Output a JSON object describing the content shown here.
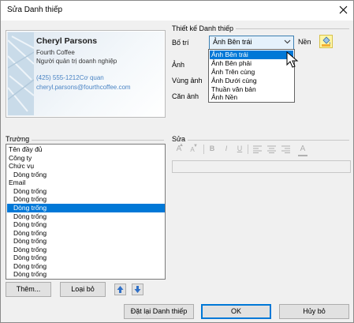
{
  "window": {
    "title": "Sửa Danh thiếp"
  },
  "card": {
    "name": "Cheryl Parsons",
    "company": "Fourth Coffee",
    "job_title": "Người quản trị doanh nghiệp",
    "phone": "(425) 555-1212Cơ quan",
    "email": "cheryl.parsons@fourthcoffee.com"
  },
  "design": {
    "section_label": "Thiết kế Danh thiếp",
    "layout_label": "Bố trí",
    "layout_value": "Ảnh Bên trái",
    "background_label": "Nền",
    "image_label": "Ảnh",
    "image_area_label": "Vùng ảnh",
    "image_align_label": "Căn ảnh",
    "layout_options": [
      {
        "label": "Ảnh Bên trái",
        "selected": true
      },
      {
        "label": "Ảnh Bên phải",
        "selected": false
      },
      {
        "label": "Ảnh Trên cùng",
        "selected": false
      },
      {
        "label": "Ảnh Dưới cùng",
        "selected": false
      },
      {
        "label": "Thuần văn bản",
        "selected": false
      },
      {
        "label": "Ảnh Nền",
        "selected": false
      }
    ]
  },
  "fields": {
    "section_label": "Trường",
    "items": [
      {
        "label": "Tên đầy đủ",
        "indent": false,
        "selected": false
      },
      {
        "label": "Công ty",
        "indent": false,
        "selected": false
      },
      {
        "label": "Chức vụ",
        "indent": false,
        "selected": false
      },
      {
        "label": "Dòng trống",
        "indent": true,
        "selected": false
      },
      {
        "label": "Email",
        "indent": false,
        "selected": false
      },
      {
        "label": "Dòng trống",
        "indent": true,
        "selected": false
      },
      {
        "label": "Dòng trống",
        "indent": true,
        "selected": false
      },
      {
        "label": "Dòng trống",
        "indent": true,
        "selected": true
      },
      {
        "label": "Dòng trống",
        "indent": true,
        "selected": false
      },
      {
        "label": "Dòng trống",
        "indent": true,
        "selected": false
      },
      {
        "label": "Dòng trống",
        "indent": true,
        "selected": false
      },
      {
        "label": "Dòng trống",
        "indent": true,
        "selected": false
      },
      {
        "label": "Dòng trống",
        "indent": true,
        "selected": false
      },
      {
        "label": "Dòng trống",
        "indent": true,
        "selected": false
      },
      {
        "label": "Dòng trống",
        "indent": true,
        "selected": false
      },
      {
        "label": "Dòng trống",
        "indent": true,
        "selected": false
      }
    ],
    "add_button": "Thêm...",
    "remove_button": "Loại bỏ"
  },
  "edit": {
    "section_label": "Sửa",
    "toolbar": {
      "grow_font": "A",
      "shrink_font": "A",
      "bold": "B",
      "italic": "I",
      "underline": "U",
      "font_color": "A"
    },
    "value": ""
  },
  "buttons": {
    "reset": "Đặt lại Danh thiếp",
    "ok": "OK",
    "cancel": "Hủy bỏ"
  },
  "colors": {
    "accent": "#0078d7",
    "dialog_bg": "#f0f0f0",
    "card_link": "#4a84c4",
    "bg_color_swatch": "#fff6a6"
  }
}
